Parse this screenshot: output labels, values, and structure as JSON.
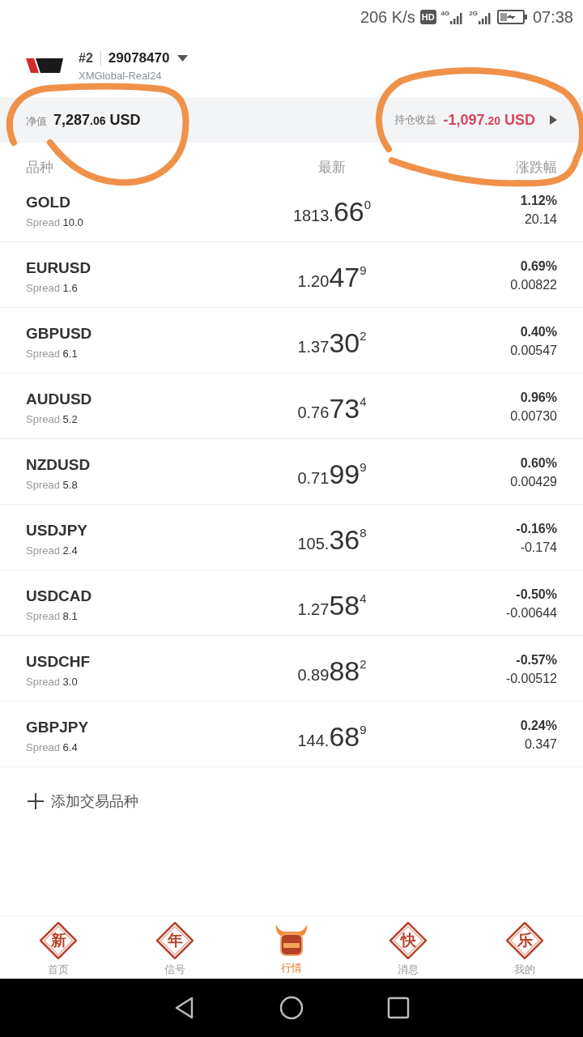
{
  "status_bar": {
    "speed": "206 K/s",
    "hd": "HD",
    "networks": [
      {
        "label": "4G"
      },
      {
        "label": "2G"
      }
    ],
    "time": "07:38"
  },
  "account": {
    "number_prefix": "#2",
    "number": "29078470",
    "server": "XMGlobal-Real24"
  },
  "summary": {
    "equity": {
      "label": "净值",
      "whole": "7,287",
      "decimals": ".06",
      "currency": "USD",
      "negative": false
    },
    "profit": {
      "label": "持仓收益",
      "whole": "-1,097",
      "decimals": ".20",
      "currency": "USD",
      "negative": true
    }
  },
  "columns": [
    "品种",
    "最新",
    "涨跌幅"
  ],
  "quotes": [
    {
      "symbol": "GOLD",
      "spread_label": "Spread",
      "spread": "10.0",
      "price_head": "1813.",
      "price_big": "66",
      "price_sup": "0",
      "change_pct": "1.12%",
      "change": "20.14"
    },
    {
      "symbol": "EURUSD",
      "spread_label": "Spread",
      "spread": "1.6",
      "price_head": "1.20",
      "price_big": "47",
      "price_sup": "9",
      "change_pct": "0.69%",
      "change": "0.00822"
    },
    {
      "symbol": "GBPUSD",
      "spread_label": "Spread",
      "spread": "6.1",
      "price_head": "1.37",
      "price_big": "30",
      "price_sup": "2",
      "change_pct": "0.40%",
      "change": "0.00547"
    },
    {
      "symbol": "AUDUSD",
      "spread_label": "Spread",
      "spread": "5.2",
      "price_head": "0.76",
      "price_big": "73",
      "price_sup": "4",
      "change_pct": "0.96%",
      "change": "0.00730"
    },
    {
      "symbol": "NZDUSD",
      "spread_label": "Spread",
      "spread": "5.8",
      "price_head": "0.71",
      "price_big": "99",
      "price_sup": "9",
      "change_pct": "0.60%",
      "change": "0.00429"
    },
    {
      "symbol": "USDJPY",
      "spread_label": "Spread",
      "spread": "2.4",
      "price_head": "105.",
      "price_big": "36",
      "price_sup": "8",
      "change_pct": "-0.16%",
      "change": "-0.174"
    },
    {
      "symbol": "USDCAD",
      "spread_label": "Spread",
      "spread": "8.1",
      "price_head": "1.27",
      "price_big": "58",
      "price_sup": "4",
      "change_pct": "-0.50%",
      "change": "-0.00644"
    },
    {
      "symbol": "USDCHF",
      "spread_label": "Spread",
      "spread": "3.0",
      "price_head": "0.89",
      "price_big": "88",
      "price_sup": "2",
      "change_pct": "-0.57%",
      "change": "-0.00512"
    },
    {
      "symbol": "GBPJPY",
      "spread_label": "Spread",
      "spread": "6.4",
      "price_head": "144.",
      "price_big": "68",
      "price_sup": "9",
      "change_pct": "0.24%",
      "change": "0.347"
    }
  ],
  "add_button": "添加交易品种",
  "tabs": [
    {
      "label": "首页",
      "glyph": "新",
      "kind": "diamond",
      "selected": false
    },
    {
      "label": "信号",
      "glyph": "年",
      "kind": "diamond",
      "selected": false
    },
    {
      "label": "行情",
      "kind": "bull",
      "selected": true
    },
    {
      "label": "消息",
      "glyph": "快",
      "kind": "diamond",
      "selected": false
    },
    {
      "label": "我的",
      "glyph": "乐",
      "kind": "diamond",
      "selected": false
    }
  ]
}
